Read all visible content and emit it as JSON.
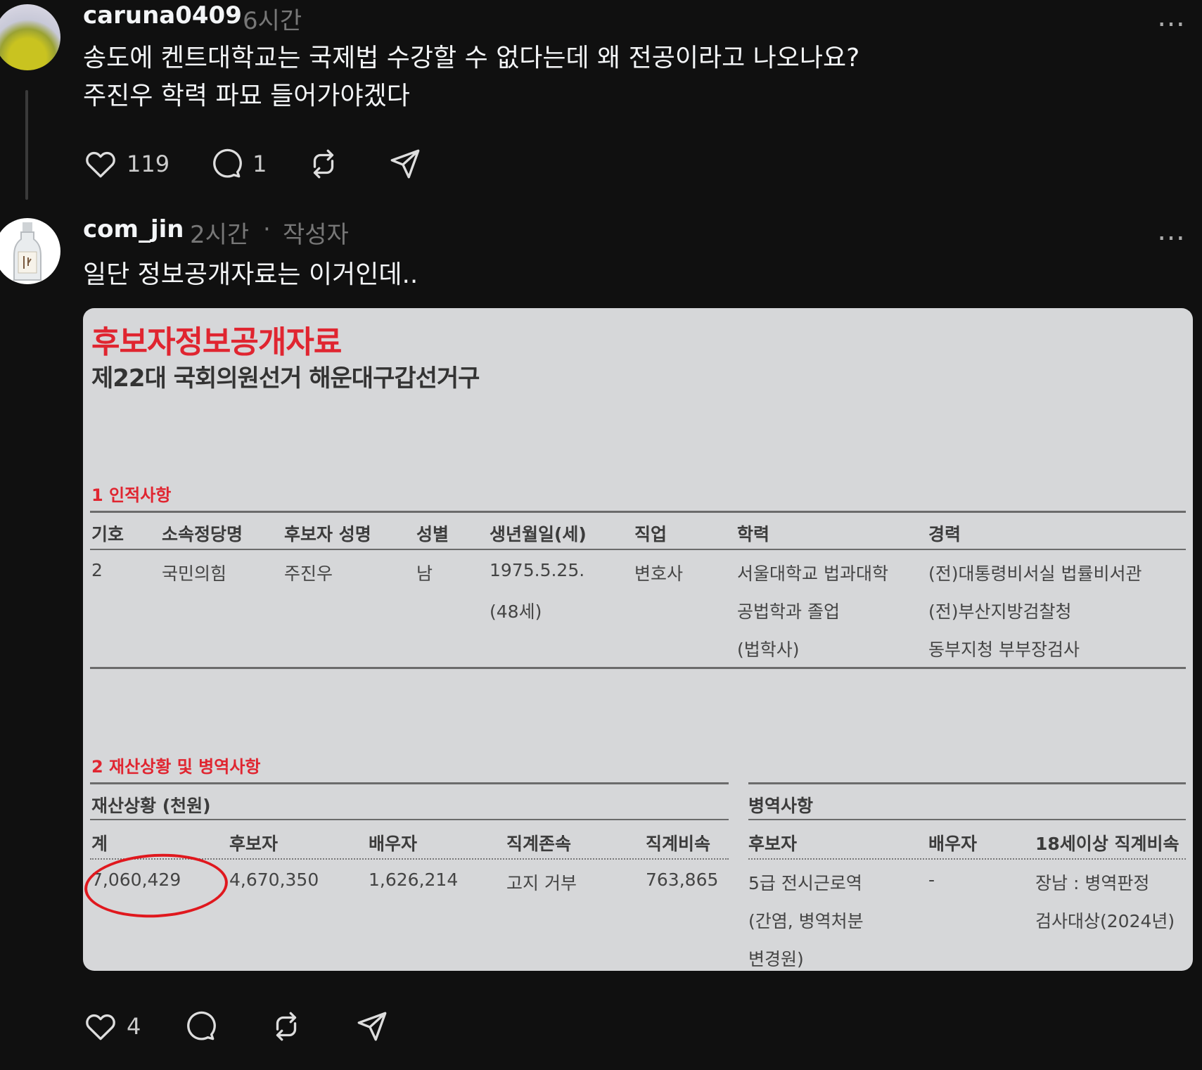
{
  "post1": {
    "username": "caruna0409",
    "time": "6시간",
    "more": "…",
    "line1": "송도에 켄트대학교는 국제법 수강할 수 없다는데 왜 전공이라고 나오나요?",
    "line2": "주진우 학력 파묘 들어가야겠다",
    "likes": "119",
    "replies": "1"
  },
  "post2": {
    "username": "com_jin",
    "time": "2시간",
    "separator": "·",
    "author_tag": "작성자",
    "more": "…",
    "text": "일단 정보공개자료는 이거인데..",
    "likes": "4"
  },
  "document": {
    "title": "후보자정보공개자료",
    "subtitle": "제22대 국회의원선거 해운대구갑선거구",
    "section1": {
      "heading": "1 인적사항",
      "headers": [
        "기호",
        "소속정당명",
        "후보자 성명",
        "성별",
        "생년월일(세)",
        "직업",
        "학력",
        "경력"
      ],
      "number": "2",
      "party": "국민의힘",
      "name": "주진우",
      "gender": "남",
      "birth": [
        "1975.5.25.",
        "(48세)"
      ],
      "job": "변호사",
      "education": [
        "서울대학교 법과대학",
        "공법학과 졸업",
        "(법학사)"
      ],
      "career": [
        "(전)대통령비서실 법률비서관",
        "(전)부산지방검찰청",
        "동부지청 부부장검사"
      ]
    },
    "section2": {
      "heading": "2 재산상황 및 병역사항",
      "assets_title": "재산상황 (천원)",
      "military_title": "병역사항",
      "asset_headers": [
        "계",
        "후보자",
        "배우자",
        "직계존속",
        "직계비속"
      ],
      "asset_values": [
        "7,060,429",
        "4,670,350",
        "1,626,214",
        "고지 거부",
        "763,865"
      ],
      "military_headers": [
        "후보자",
        "배우자",
        "18세이상 직계비속"
      ],
      "military_candidate": [
        "5급 전시근로역",
        "(간염, 병역처분",
        "변경원)"
      ],
      "military_spouse": "-",
      "military_children": [
        "장남 : 병역판정",
        "검사대상(2024년)"
      ]
    }
  },
  "colors": {
    "background": "#101010",
    "accent_red": "#e02530",
    "document_bg": "#d6d7d9"
  }
}
